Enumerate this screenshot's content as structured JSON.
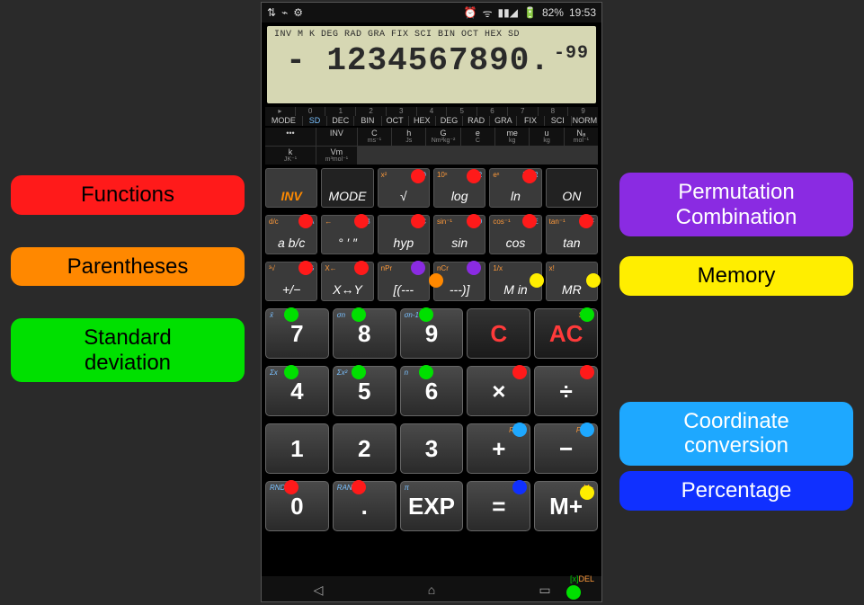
{
  "status": {
    "time": "19:53",
    "battery": "82%",
    "left_icons": [
      "usb",
      "bulb",
      "gear"
    ],
    "right_icons": [
      "alarm",
      "wifi",
      "signal"
    ]
  },
  "lcd": {
    "indicators": "INV M K DEG RAD GRA FIX SCI BIN OCT HEX SD",
    "main": "- 1234567890.",
    "exp": "-99"
  },
  "mode_row": {
    "headers": [
      "▸",
      "",
      "0",
      "1",
      "2",
      "3",
      "4",
      "5",
      "6",
      "7",
      "8",
      "9"
    ],
    "labels": [
      "MODE",
      "SD",
      "DEC",
      "BIN",
      "OCT",
      "HEX",
      "DEG",
      "RAD",
      "GRA",
      "FIX",
      "SCI",
      "NORM"
    ]
  },
  "const_row": [
    "•••",
    "INV",
    "C",
    "h",
    "G",
    "e",
    "me",
    "u",
    "Nₐ",
    "k",
    "Vm"
  ],
  "const_sub": [
    "",
    "",
    "ms⁻¹",
    "Js",
    "Nm²kg⁻²",
    "C",
    "kg",
    "kg",
    "mol⁻¹",
    "JK⁻¹",
    "m³mol⁻¹"
  ],
  "srow1": [
    {
      "main": "INV",
      "supL": "",
      "supR": ""
    },
    {
      "main": "MODE",
      "supL": "",
      "supR": ""
    },
    {
      "main": "√",
      "supL": "x²",
      "supR": "AND"
    },
    {
      "main": "log",
      "supL": "10ˣ",
      "supR": "OR"
    },
    {
      "main": "ln",
      "supL": "eˣ",
      "supR": "XOR"
    },
    {
      "main": "ON",
      "supL": "",
      "supR": ""
    }
  ],
  "srow2": [
    {
      "main": "a b/c",
      "supL": "d/c",
      "supR": "A"
    },
    {
      "main": "° ′ ″",
      "supL": "←",
      "supR": "B"
    },
    {
      "main": "hyp",
      "supL": "",
      "supR": "C"
    },
    {
      "main": "sin",
      "supL": "sin⁻¹",
      "supR": "D"
    },
    {
      "main": "cos",
      "supL": "cos⁻¹",
      "supR": "E"
    },
    {
      "main": "tan",
      "supL": "tan⁻¹",
      "supR": "F"
    }
  ],
  "srow3": [
    {
      "main": "+/−",
      "supL": "³√",
      "supR": "NEG"
    },
    {
      "main": "X↔Y",
      "supL": "X←",
      "supR": ""
    },
    {
      "main": "[(---",
      "supL": "nPr",
      "supR": ""
    },
    {
      "main": "---)]",
      "supL": "nCr",
      "supR": ""
    },
    {
      "main": "M in",
      "supL": "1/x",
      "supR": ""
    },
    {
      "main": "MR",
      "supL": "x!",
      "supR": ""
    }
  ],
  "brow1": [
    {
      "main": "7",
      "tl": "x̄",
      "tr": ""
    },
    {
      "main": "8",
      "tl": "σn",
      "tr": ""
    },
    {
      "main": "9",
      "tl": "σn-1",
      "tr": ""
    },
    {
      "main": "C",
      "tl": "",
      "tr": ""
    },
    {
      "main": "AC",
      "tl": "",
      "tr": "SAC"
    }
  ],
  "brow2": [
    {
      "main": "4",
      "tl": "Σx",
      "tr": ""
    },
    {
      "main": "5",
      "tl": "Σx²",
      "tr": ""
    },
    {
      "main": "6",
      "tl": "n",
      "tr": ""
    },
    {
      "main": "×",
      "tl": "",
      "tr": "xʸ"
    },
    {
      "main": "÷",
      "tl": "",
      "tr": "x¹/ʸ"
    }
  ],
  "brow3": [
    {
      "main": "1",
      "tl": "",
      "tr": ""
    },
    {
      "main": "2",
      "tl": "",
      "tr": ""
    },
    {
      "main": "3",
      "tl": "",
      "tr": ""
    },
    {
      "main": "+",
      "tl": "",
      "tr": "R→P"
    },
    {
      "main": "−",
      "tl": "",
      "tr": "P→R"
    }
  ],
  "brow4": [
    {
      "main": "0",
      "tl": "RND",
      "tr": ""
    },
    {
      "main": ".",
      "tl": "RAN#",
      "tr": ""
    },
    {
      "main": "EXP",
      "tl": "π",
      "tr": ""
    },
    {
      "main": "=",
      "tl": "",
      "tr": "%"
    },
    {
      "main": "M+",
      "tl": "",
      "tr": "M−"
    }
  ],
  "xdel": {
    "x": "[x]",
    "del": "DEL"
  },
  "legend_left": [
    {
      "label": "Functions",
      "color": "red"
    },
    {
      "label": "Parentheses",
      "color": "orange"
    },
    {
      "label": "Standard\ndeviation",
      "color": "green"
    }
  ],
  "legend_right": [
    {
      "label": "Permutation\nCombination",
      "color": "purple",
      "mb": 22
    },
    {
      "label": "Memory",
      "color": "yellow",
      "mb": 118
    },
    {
      "label": "Coordinate\nconversion",
      "color": "sky",
      "mb": 6
    },
    {
      "label": "Percentage",
      "color": "blue",
      "mb": 0
    }
  ],
  "dots": [
    {
      "c": "red",
      "k": "srow1-2"
    },
    {
      "c": "red",
      "k": "srow1-3"
    },
    {
      "c": "red",
      "k": "srow1-4"
    },
    {
      "c": "red",
      "k": "srow2-0"
    },
    {
      "c": "red",
      "k": "srow2-1"
    },
    {
      "c": "red",
      "k": "srow2-2"
    },
    {
      "c": "red",
      "k": "srow2-3"
    },
    {
      "c": "red",
      "k": "srow2-4"
    },
    {
      "c": "red",
      "k": "srow2-5"
    },
    {
      "c": "red",
      "k": "srow3-0"
    },
    {
      "c": "red",
      "k": "srow3-1"
    },
    {
      "c": "purple",
      "k": "srow3-2"
    },
    {
      "c": "purple",
      "k": "srow3-3"
    },
    {
      "c": "orange",
      "k": "srow3-2b"
    },
    {
      "c": "yellow",
      "k": "srow3-4"
    },
    {
      "c": "yellow",
      "k": "srow3-5"
    },
    {
      "c": "green",
      "k": "brow1-0"
    },
    {
      "c": "green",
      "k": "brow1-1"
    },
    {
      "c": "green",
      "k": "brow1-2"
    },
    {
      "c": "green",
      "k": "brow1-4"
    },
    {
      "c": "green",
      "k": "brow2-0"
    },
    {
      "c": "green",
      "k": "brow2-1"
    },
    {
      "c": "green",
      "k": "brow2-2"
    },
    {
      "c": "red",
      "k": "brow2-3"
    },
    {
      "c": "red",
      "k": "brow2-4"
    },
    {
      "c": "sky",
      "k": "brow3-3"
    },
    {
      "c": "sky",
      "k": "brow3-4"
    },
    {
      "c": "red",
      "k": "brow4-0"
    },
    {
      "c": "red",
      "k": "brow4-1"
    },
    {
      "c": "blue",
      "k": "brow4-3"
    },
    {
      "c": "yellow",
      "k": "brow4-4"
    },
    {
      "c": "green",
      "k": "xdel"
    }
  ],
  "dot_pos": {
    "srow1-2": [
      36,
      0
    ],
    "srow1-3": [
      36,
      0
    ],
    "srow1-4": [
      36,
      0
    ],
    "srow2-0": [
      36,
      -2
    ],
    "srow2-1": [
      36,
      -2
    ],
    "srow2-2": [
      36,
      -2
    ],
    "srow2-3": [
      36,
      -2
    ],
    "srow2-4": [
      36,
      -2
    ],
    "srow2-5": [
      36,
      -2
    ],
    "srow3-0": [
      36,
      -2
    ],
    "srow3-1": [
      36,
      -2
    ],
    "srow3-2": [
      36,
      -2
    ],
    "srow3-3": [
      36,
      -2
    ],
    "srow3-2b": [
      56,
      12
    ],
    "srow3-4": [
      44,
      12
    ],
    "srow3-5": [
      44,
      12
    ],
    "brow1-0": [
      20,
      -2
    ],
    "brow1-1": [
      20,
      -2
    ],
    "brow1-2": [
      20,
      -2
    ],
    "brow1-4": [
      50,
      -2
    ],
    "brow2-0": [
      20,
      -2
    ],
    "brow2-1": [
      20,
      -2
    ],
    "brow2-2": [
      20,
      -2
    ],
    "brow2-3": [
      50,
      -2
    ],
    "brow2-4": [
      50,
      -2
    ],
    "brow3-3": [
      50,
      -2
    ],
    "brow3-4": [
      50,
      -2
    ],
    "brow4-0": [
      20,
      -2
    ],
    "brow4-1": [
      20,
      -2
    ],
    "brow4-3": [
      50,
      -2
    ],
    "brow4-4": [
      50,
      4
    ],
    "xdel": [
      0,
      0
    ]
  }
}
